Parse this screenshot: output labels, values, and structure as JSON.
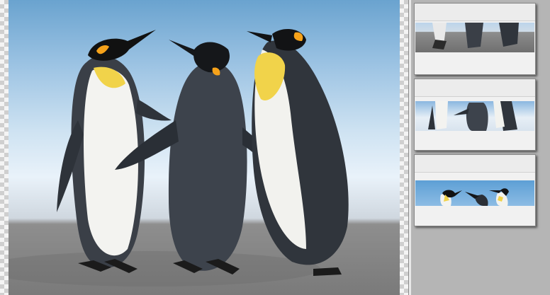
{
  "window": {
    "background": "#b5b5b5"
  },
  "main_image": {
    "subject": "penguins-photo"
  },
  "thumbnails": [
    {
      "name": "thumbnail-1"
    },
    {
      "name": "thumbnail-2"
    },
    {
      "name": "thumbnail-3"
    }
  ]
}
